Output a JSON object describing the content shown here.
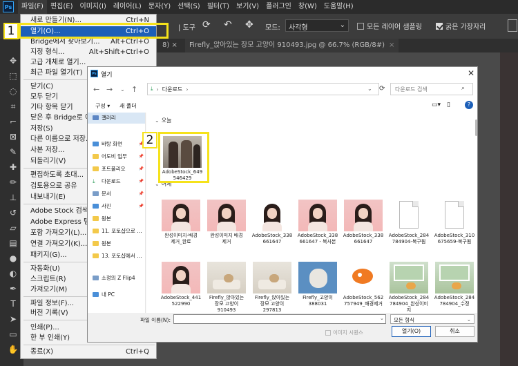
{
  "photoshop": {
    "logo": "Ps",
    "menu": [
      "파일(F)",
      "편집(E)",
      "이미지(I)",
      "레이어(L)",
      "문자(Y)",
      "선택(S)",
      "필터(T)",
      "보기(V)",
      "플러그인",
      "창(W)",
      "도움말(H)"
    ],
    "options": {
      "tool_text": "| 도구",
      "mode_label": "모드:",
      "mode_value": "사각형",
      "sample_all_layers": "모든 레이어 샘플링",
      "sample_all_checked": false,
      "hard_edge": "굵은 가장자리",
      "hard_edge_checked": true
    },
    "doc_tabs": [
      {
        "label": "8) ×"
      },
      {
        "label": "Firefly_앉아있는 장모 고양이 910493.jpg @ 66.7% (RGB/8#)",
        "close": "×"
      }
    ]
  },
  "file_menu": {
    "items": [
      {
        "label": "새로 만들기(N)...",
        "shortcut": "Ctrl+N"
      },
      {
        "label": "열기(O)...",
        "shortcut": "Ctrl+O",
        "highlighted": true
      },
      {
        "label": "Bridge에서 찾아보기...",
        "shortcut": "Alt+Ctrl+O"
      },
      {
        "label": "지정 형식...",
        "shortcut": "Alt+Shift+Ctrl+O"
      },
      {
        "label": "고급 개체로 열기...",
        "shortcut": ""
      },
      {
        "label": "최근 파일 열기(T)",
        "shortcut": "▸"
      },
      {
        "label": "닫기(C)",
        "shortcut": ""
      },
      {
        "label": "모두 닫기",
        "shortcut": ""
      },
      {
        "label": "기타 항목 닫기",
        "shortcut": ""
      },
      {
        "label": "닫은 후 Bridge로 이동...",
        "shortcut": ""
      },
      {
        "label": "저장(S)",
        "shortcut": ""
      },
      {
        "label": "다른 이름으로 저장...",
        "shortcut": ""
      },
      {
        "label": "사본 저장...",
        "shortcut": ""
      },
      {
        "label": "되돌리기(V)",
        "shortcut": ""
      },
      {
        "label": "편집하도록 초대...",
        "shortcut": ""
      },
      {
        "label": "검토용으로 공유",
        "shortcut": ""
      },
      {
        "label": "내보내기(E)",
        "shortcut": ""
      },
      {
        "label": "Adobe Stock 검색...",
        "shortcut": ""
      },
      {
        "label": "Adobe Express 템플릿",
        "shortcut": ""
      },
      {
        "label": "포함 가져오기(L)...",
        "shortcut": ""
      },
      {
        "label": "연결 가져오기(K)...",
        "shortcut": ""
      },
      {
        "label": "패키지(G)...",
        "shortcut": ""
      },
      {
        "label": "자동화(U)",
        "shortcut": ""
      },
      {
        "label": "스크립트(R)",
        "shortcut": ""
      },
      {
        "label": "가져오기(M)",
        "shortcut": ""
      },
      {
        "label": "파일 정보(F)...",
        "shortcut": ""
      },
      {
        "label": "버전 기록(V)",
        "shortcut": ""
      },
      {
        "label": "인쇄(P)...",
        "shortcut": ""
      },
      {
        "label": "한 부 인쇄(Y)",
        "shortcut": ""
      },
      {
        "label": "종료(X)",
        "shortcut": "Ctrl+Q"
      }
    ]
  },
  "callouts": {
    "one": "1",
    "two": "2"
  },
  "dialog": {
    "title": "열기",
    "close": "✕",
    "path": "다운로드",
    "search_placeholder": "다운로드 검색",
    "organize": "구성 ▾",
    "new_folder": "새 폴더",
    "nav_items": [
      {
        "label": "갤러리",
        "icon": "gallery-icon",
        "selected": true
      },
      {
        "label": "바탕 화면",
        "icon": "desktop-icon",
        "pin": true
      },
      {
        "label": "어도비 업무",
        "icon": "folder-icon",
        "pin": true
      },
      {
        "label": "포트폴리오",
        "icon": "folder-icon",
        "pin": true
      },
      {
        "label": "다운로드",
        "icon": "download-icon",
        "pin": true
      },
      {
        "label": "문서",
        "icon": "documents-icon",
        "pin": true
      },
      {
        "label": "사진",
        "icon": "pictures-icon",
        "pin": true
      },
      {
        "label": "원본",
        "icon": "folder-icon"
      },
      {
        "label": "11. 포토샵으로 …",
        "icon": "folder-icon"
      },
      {
        "label": "원본",
        "icon": "folder-icon"
      },
      {
        "label": "13. 포토샵에서 …",
        "icon": "folder-icon"
      },
      {
        "label": "소정의 Z Flip4",
        "icon": "phone-icon"
      },
      {
        "label": "내 PC",
        "icon": "pc-icon"
      }
    ],
    "groups": {
      "today": "오늘",
      "yesterday": "어제"
    },
    "today_files": [
      {
        "caption": "AdobeStock_649\n546429",
        "thumb": "portrait"
      }
    ],
    "yesterday_files": [
      {
        "caption": "완성이미지-배경\n제거_완료",
        "thumb": "pink"
      },
      {
        "caption": "완성이미지 배경\n제거",
        "thumb": "pink"
      },
      {
        "caption": "AdobeStock_338\n661647",
        "thumb": "pink"
      },
      {
        "caption": "AdobeStock_338\n661647 - 복사본",
        "thumb": "pink"
      },
      {
        "caption": "AdobeStock_338\n661647",
        "thumb": "pink"
      },
      {
        "caption": "AdobeStock_284\n784904-복구됨",
        "thumb": "doc"
      },
      {
        "caption": "AdobeStock_310\n675659-복구됨",
        "thumb": "doc"
      },
      {
        "caption": "AdobeStock_441\n522990",
        "thumb": "pink"
      },
      {
        "caption": "Firefly_앉아있는\n장모 고양이\n910493",
        "thumb": "room"
      },
      {
        "caption": "Firefly_앉아있는\n장모 고양이\n297813",
        "thumb": "room"
      },
      {
        "caption": "Firefly_고양이\n388031",
        "thumb": "catblue"
      },
      {
        "caption": "AdobeStock_562\n757949_배경제거",
        "thumb": "fish"
      },
      {
        "caption": "AdobeStock_284\n784904_완성이미\n지",
        "thumb": "green"
      },
      {
        "caption": "AdobeStock_284\n784904_수정",
        "thumb": "green"
      }
    ],
    "filename_label": "파일 이름(N):",
    "filename_value": "",
    "filetype": "모든 형식",
    "image_sequence": "이미지 시퀀스",
    "open_button": "열기(O)",
    "cancel_button": "취소"
  }
}
